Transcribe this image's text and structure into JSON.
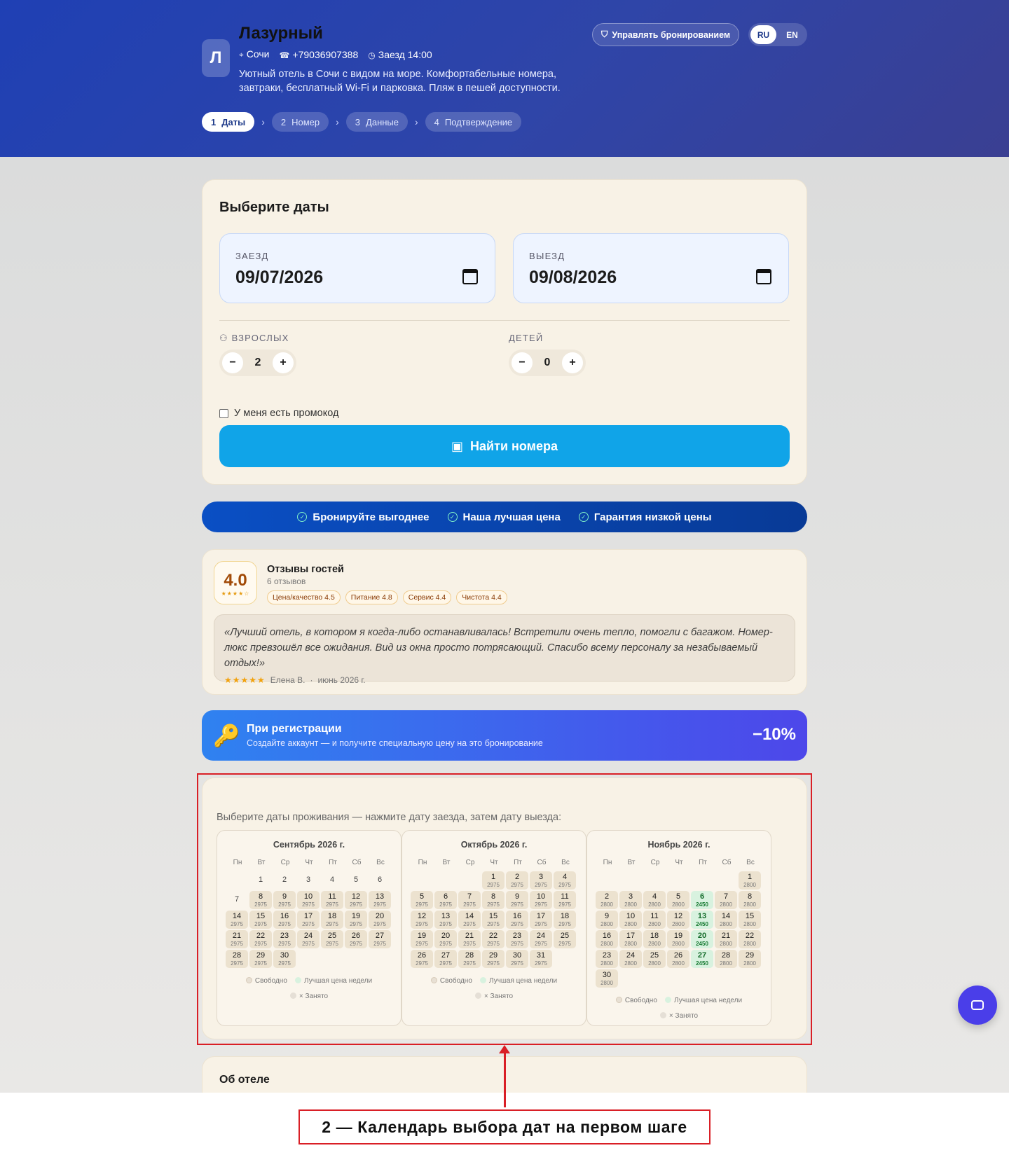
{
  "header": {
    "avatar_letter": "Л",
    "hotel_name": "Лазурный",
    "city": "Сочи",
    "phone": "+79036907388",
    "checkin_time": "Заезд 14:00",
    "description": "Уютный отель в Сочи с видом на море. Комфортабельные номера, завтраки, бесплатный Wi-Fi и парковка. Пляж в пешей доступности.",
    "manage_booking": "Управлять бронированием",
    "languages": [
      "RU",
      "EN"
    ],
    "active_language": "RU",
    "steps": [
      {
        "num": "1",
        "label": "Даты"
      },
      {
        "num": "2",
        "label": "Номер"
      },
      {
        "num": "3",
        "label": "Данные"
      },
      {
        "num": "4",
        "label": "Подтверждение"
      }
    ]
  },
  "search": {
    "title": "Выберите даты",
    "checkin_label": "ЗАЕЗД",
    "checkin_value": "09/07/2026",
    "checkout_label": "ВЫЕЗД",
    "checkout_value": "09/08/2026",
    "adults_label": "ВЗРОСЛЫХ",
    "adults_value": "2",
    "children_label": "ДЕТЕЙ",
    "children_value": "0",
    "promo_label": "У меня есть промокод",
    "find_button": "Найти номера"
  },
  "benefits": [
    "Бронируйте выгоднее",
    "Наша лучшая цена",
    "Гарантия низкой цены"
  ],
  "reviews": {
    "score": "4.0",
    "stars": "★★★★☆",
    "title": "Отзывы гостей",
    "count": "6 отзывов",
    "tags": [
      "Цена/качество 4.5",
      "Питание 4.8",
      "Сервис 4.4",
      "Чистота 4.4"
    ],
    "quote": "«Лучший отель, в котором я когда-либо останавливалась! Встретили очень тепло, помогли с багажом. Номер-люкс превзошёл все ожидания. Вид из окна просто потрясающий. Спасибо всему персоналу за незабываемый отдых!»",
    "quote_stars": "★★★★★",
    "author": "Елена В.",
    "separator": "·",
    "date": "июнь 2026 г."
  },
  "promo_banner": {
    "icon": "🔑",
    "title": "При регистрации",
    "text": "Создайте аккаунт — и получите специальную цену на это бронирование",
    "discount": "−10%"
  },
  "calendar": {
    "intro": "Выберите даты проживания — нажмите дату заезда, затем дату выезда:",
    "weekdays": [
      "Пн",
      "Вт",
      "Ср",
      "Чт",
      "Пт",
      "Сб",
      "Вс"
    ],
    "legend_free": "Свободно",
    "legend_best": "Лучшая цена недели",
    "legend_busy": "× Занято",
    "months": [
      {
        "title": "Сентябрь 2026 г.",
        "offset": 1,
        "days": [
          {
            "d": "1"
          },
          {
            "d": "2"
          },
          {
            "d": "3"
          },
          {
            "d": "4"
          },
          {
            "d": "5"
          },
          {
            "d": "6"
          },
          {
            "d": "7"
          },
          {
            "d": "8",
            "p": "2975"
          },
          {
            "d": "9",
            "p": "2975"
          },
          {
            "d": "10",
            "p": "2975"
          },
          {
            "d": "11",
            "p": "2975"
          },
          {
            "d": "12",
            "p": "2975"
          },
          {
            "d": "13",
            "p": "2975"
          },
          {
            "d": "14",
            "p": "2975"
          },
          {
            "d": "15",
            "p": "2975"
          },
          {
            "d": "16",
            "p": "2975"
          },
          {
            "d": "17",
            "p": "2975"
          },
          {
            "d": "18",
            "p": "2975"
          },
          {
            "d": "19",
            "p": "2975"
          },
          {
            "d": "20",
            "p": "2975"
          },
          {
            "d": "21",
            "p": "2975"
          },
          {
            "d": "22",
            "p": "2975"
          },
          {
            "d": "23",
            "p": "2975"
          },
          {
            "d": "24",
            "p": "2975"
          },
          {
            "d": "25",
            "p": "2975"
          },
          {
            "d": "26",
            "p": "2975"
          },
          {
            "d": "27",
            "p": "2975"
          },
          {
            "d": "28",
            "p": "2975"
          },
          {
            "d": "29",
            "p": "2975"
          },
          {
            "d": "30",
            "p": "2975"
          }
        ]
      },
      {
        "title": "Октябрь 2026 г.",
        "offset": 3,
        "days": [
          {
            "d": "1",
            "p": "2975"
          },
          {
            "d": "2",
            "p": "2975"
          },
          {
            "d": "3",
            "p": "2975"
          },
          {
            "d": "4",
            "p": "2975"
          },
          {
            "d": "5",
            "p": "2975"
          },
          {
            "d": "6",
            "p": "2975"
          },
          {
            "d": "7",
            "p": "2975"
          },
          {
            "d": "8",
            "p": "2975"
          },
          {
            "d": "9",
            "p": "2975"
          },
          {
            "d": "10",
            "p": "2975"
          },
          {
            "d": "11",
            "p": "2975"
          },
          {
            "d": "12",
            "p": "2975"
          },
          {
            "d": "13",
            "p": "2975"
          },
          {
            "d": "14",
            "p": "2975"
          },
          {
            "d": "15",
            "p": "2975"
          },
          {
            "d": "16",
            "p": "2975"
          },
          {
            "d": "17",
            "p": "2975"
          },
          {
            "d": "18",
            "p": "2975"
          },
          {
            "d": "19",
            "p": "2975"
          },
          {
            "d": "20",
            "p": "2975"
          },
          {
            "d": "21",
            "p": "2975"
          },
          {
            "d": "22",
            "p": "2975"
          },
          {
            "d": "23",
            "p": "2975"
          },
          {
            "d": "24",
            "p": "2975"
          },
          {
            "d": "25",
            "p": "2975"
          },
          {
            "d": "26",
            "p": "2975"
          },
          {
            "d": "27",
            "p": "2975"
          },
          {
            "d": "28",
            "p": "2975"
          },
          {
            "d": "29",
            "p": "2975"
          },
          {
            "d": "30",
            "p": "2975"
          },
          {
            "d": "31",
            "p": "2975"
          }
        ]
      },
      {
        "title": "Ноябрь 2026 г.",
        "offset": 6,
        "days": [
          {
            "d": "1",
            "p": "2800"
          },
          {
            "d": "2",
            "p": "2800"
          },
          {
            "d": "3",
            "p": "2800"
          },
          {
            "d": "4",
            "p": "2800"
          },
          {
            "d": "5",
            "p": "2800"
          },
          {
            "d": "6",
            "p": "2450",
            "best": true
          },
          {
            "d": "7",
            "p": "2800"
          },
          {
            "d": "8",
            "p": "2800"
          },
          {
            "d": "9",
            "p": "2800"
          },
          {
            "d": "10",
            "p": "2800"
          },
          {
            "d": "11",
            "p": "2800"
          },
          {
            "d": "12",
            "p": "2800"
          },
          {
            "d": "13",
            "p": "2450",
            "best": true
          },
          {
            "d": "14",
            "p": "2800"
          },
          {
            "d": "15",
            "p": "2800"
          },
          {
            "d": "16",
            "p": "2800"
          },
          {
            "d": "17",
            "p": "2800"
          },
          {
            "d": "18",
            "p": "2800"
          },
          {
            "d": "19",
            "p": "2800"
          },
          {
            "d": "20",
            "p": "2450",
            "best": true
          },
          {
            "d": "21",
            "p": "2800"
          },
          {
            "d": "22",
            "p": "2800"
          },
          {
            "d": "23",
            "p": "2800"
          },
          {
            "d": "24",
            "p": "2800"
          },
          {
            "d": "25",
            "p": "2800"
          },
          {
            "d": "26",
            "p": "2800"
          },
          {
            "d": "27",
            "p": "2450",
            "best": true
          },
          {
            "d": "28",
            "p": "2800"
          },
          {
            "d": "29",
            "p": "2800"
          },
          {
            "d": "30",
            "p": "2800"
          }
        ]
      }
    ]
  },
  "about_title": "Об отеле",
  "annotation_caption": "2 — Календарь выбора дат на первом шаге",
  "colors": {
    "hero": "#2240b2",
    "cta": "#10a4e8",
    "benefit_bar": "#0a4fc4",
    "promo_gradient_start": "#2f82f0",
    "promo_gradient_end": "#4d47ea",
    "best_price": "#d8f2df",
    "annotation": "#d91f26"
  },
  "icons": [
    "location-icon",
    "phone-icon",
    "clock-icon",
    "shield-icon",
    "calendar-icon",
    "people-icon",
    "check-circle-icon",
    "key-icon",
    "chat-icon"
  ]
}
